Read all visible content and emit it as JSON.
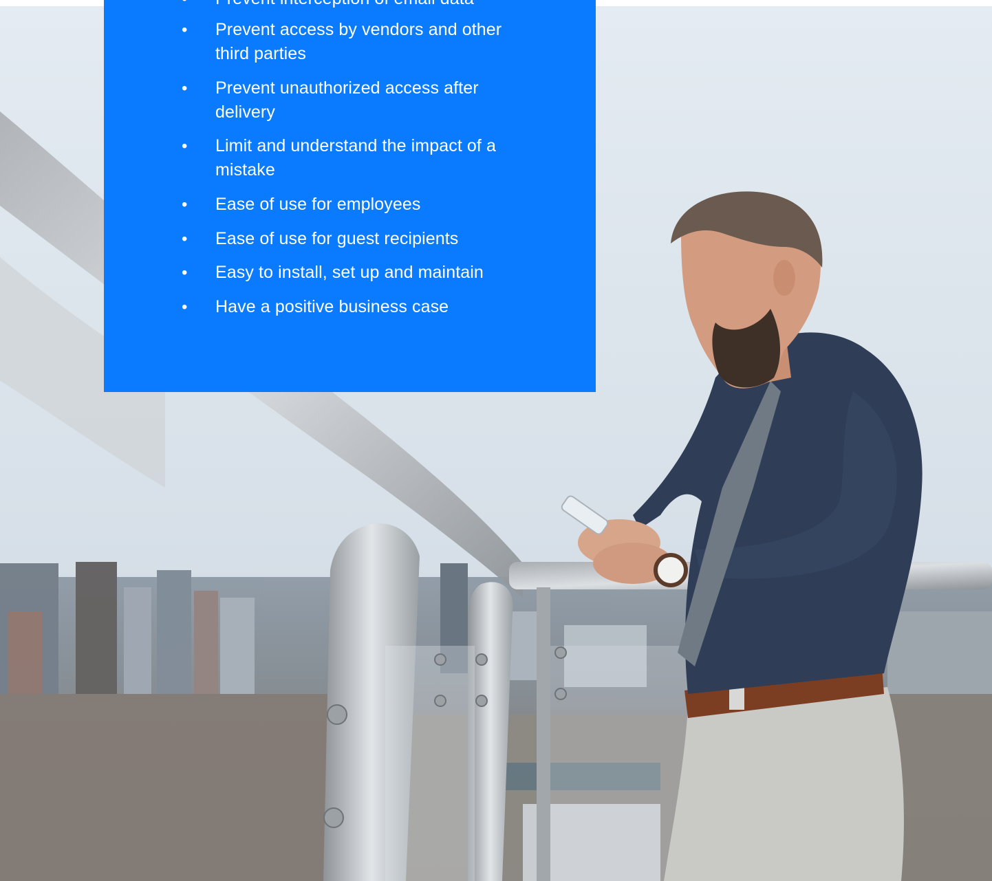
{
  "benefits_panel": {
    "background_color": "#0a7bff",
    "text_color": "#ffffff",
    "bullet_symbol": "•",
    "items": [
      {
        "text": "Prevent interception of email data"
      },
      {
        "text": "Prevent access by vendors and other third parties"
      },
      {
        "text": "Prevent unauthorized access after delivery"
      },
      {
        "text": "Limit and understand the impact of a mistake"
      },
      {
        "text": "Ease of use for employees"
      },
      {
        "text": "Ease of use for guest recipients"
      },
      {
        "text": "Easy to install, set up and maintain"
      },
      {
        "text": "Have a positive business case"
      }
    ]
  },
  "hero_photo": {
    "subject": "man-with-smartphone-on-balcony"
  }
}
